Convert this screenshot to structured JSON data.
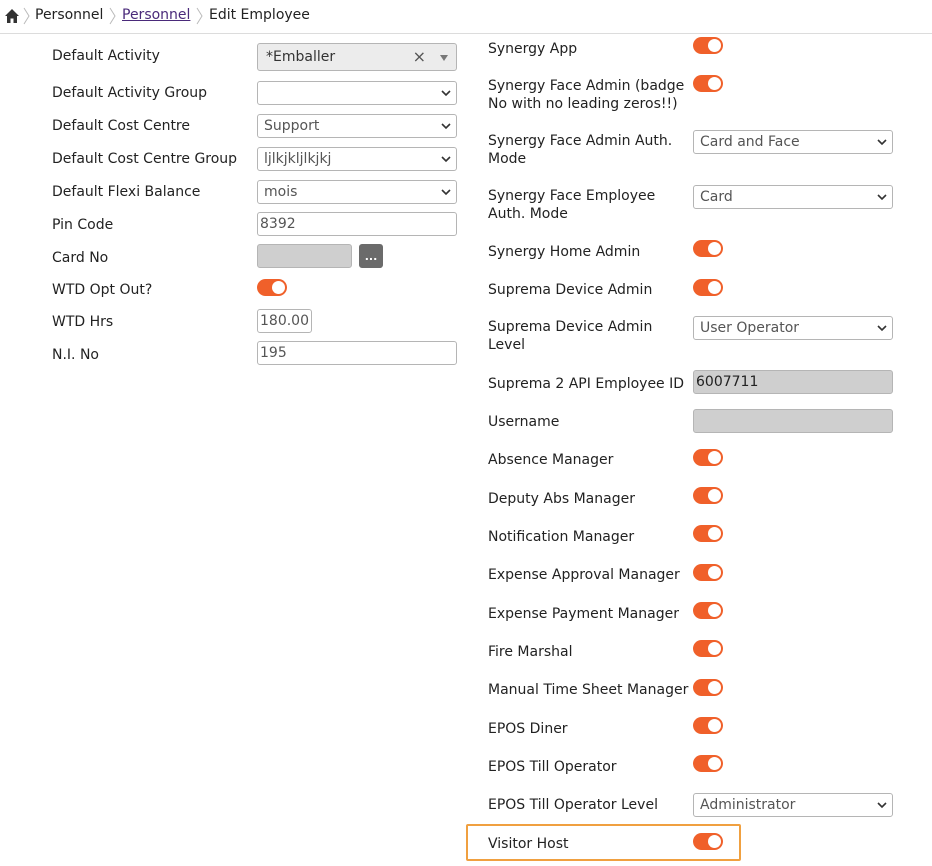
{
  "breadcrumb": {
    "items": [
      "Personnel",
      "Personnel",
      "Edit Employee"
    ]
  },
  "left": {
    "default_activity": {
      "label": "Default Activity",
      "value": "*Emballer",
      "clear": "×"
    },
    "default_activity_group": {
      "label": "Default Activity Group",
      "value": ""
    },
    "default_cost_centre": {
      "label": "Default Cost Centre",
      "value": "Support"
    },
    "default_cost_centre_group": {
      "label": "Default Cost Centre Group",
      "value": "ljlkjkljlkjkj"
    },
    "default_flexi_balance": {
      "label": "Default Flexi Balance",
      "value": "mois"
    },
    "pin_code": {
      "label": "Pin Code",
      "value": "8392"
    },
    "card_no": {
      "label": "Card No",
      "value": "",
      "button": "..."
    },
    "wtd_opt_out": {
      "label": "WTD Opt Out?",
      "on": true
    },
    "wtd_hrs": {
      "label": "WTD Hrs",
      "value": "180.00"
    },
    "ni_no": {
      "label": "N.I. No",
      "value": "195"
    }
  },
  "right": {
    "synergy_app": {
      "label": "Synergy App",
      "on": true
    },
    "synergy_face_admin": {
      "label": "Synergy Face Admin (badge No with no leading zeros!!)",
      "on": true
    },
    "synergy_face_admin_auth_mode": {
      "label": "Synergy Face Admin Auth. Mode",
      "value": "Card and Face"
    },
    "synergy_face_employee_auth_mode": {
      "label": "Synergy Face Employee Auth. Mode",
      "value": "Card"
    },
    "synergy_home_admin": {
      "label": "Synergy Home Admin",
      "on": true
    },
    "suprema_device_admin": {
      "label": "Suprema Device Admin",
      "on": true
    },
    "suprema_device_admin_level": {
      "label": "Suprema Device Admin Level",
      "value": "User Operator"
    },
    "suprema2_api_employee_id": {
      "label": "Suprema 2 API Employee ID",
      "value": "6007711"
    },
    "username": {
      "label": "Username",
      "value": ""
    },
    "absence_manager": {
      "label": "Absence Manager",
      "on": true
    },
    "deputy_abs_manager": {
      "label": "Deputy Abs Manager",
      "on": true
    },
    "notification_manager": {
      "label": "Notification Manager",
      "on": true
    },
    "expense_approval_manager": {
      "label": "Expense Approval Manager",
      "on": true
    },
    "expense_payment_manager": {
      "label": "Expense Payment Manager",
      "on": true
    },
    "fire_marshal": {
      "label": "Fire Marshal",
      "on": true
    },
    "manual_time_sheet_manager": {
      "label": "Manual Time Sheet Manager",
      "on": true
    },
    "epos_diner": {
      "label": "EPOS Diner",
      "on": true
    },
    "epos_till_operator": {
      "label": "EPOS Till Operator",
      "on": true
    },
    "epos_till_operator_level": {
      "label": "EPOS Till Operator Level",
      "value": "Administrator"
    },
    "visitor_host": {
      "label": "Visitor Host",
      "on": true
    }
  },
  "colors": {
    "toggle_on": "#f0602a",
    "highlight": "#f0a040",
    "link": "#4a2a7a"
  }
}
